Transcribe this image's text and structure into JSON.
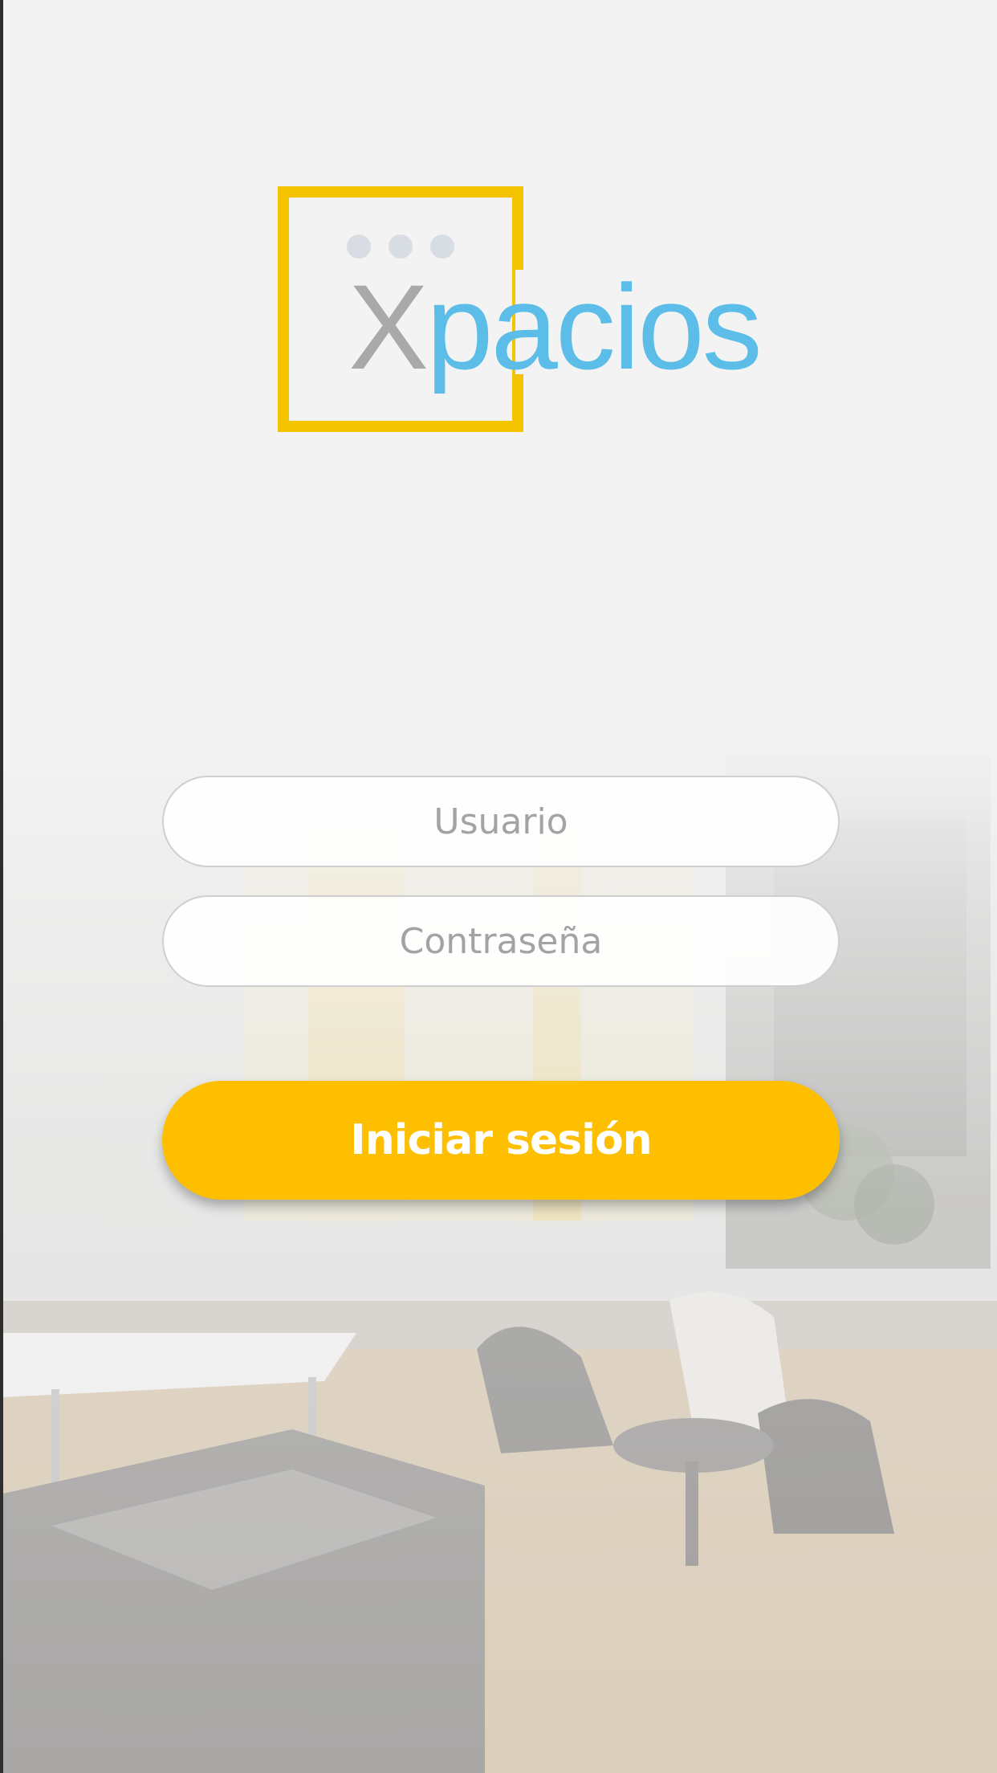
{
  "app": {
    "brand_prefix": "X",
    "brand_suffix": "pacios"
  },
  "login_form": {
    "username_placeholder": "Usuario",
    "password_placeholder": "Contraseña",
    "submit_label": "Iniciar sesión"
  },
  "colors": {
    "accent": "#fdbf00",
    "logo_frame": "#f5c400",
    "logo_text_blue": "#5bbde8",
    "logo_text_grey": "#a9a9a9",
    "background": "#f3f3f3"
  },
  "icons": [
    "logo-dots-icon"
  ]
}
